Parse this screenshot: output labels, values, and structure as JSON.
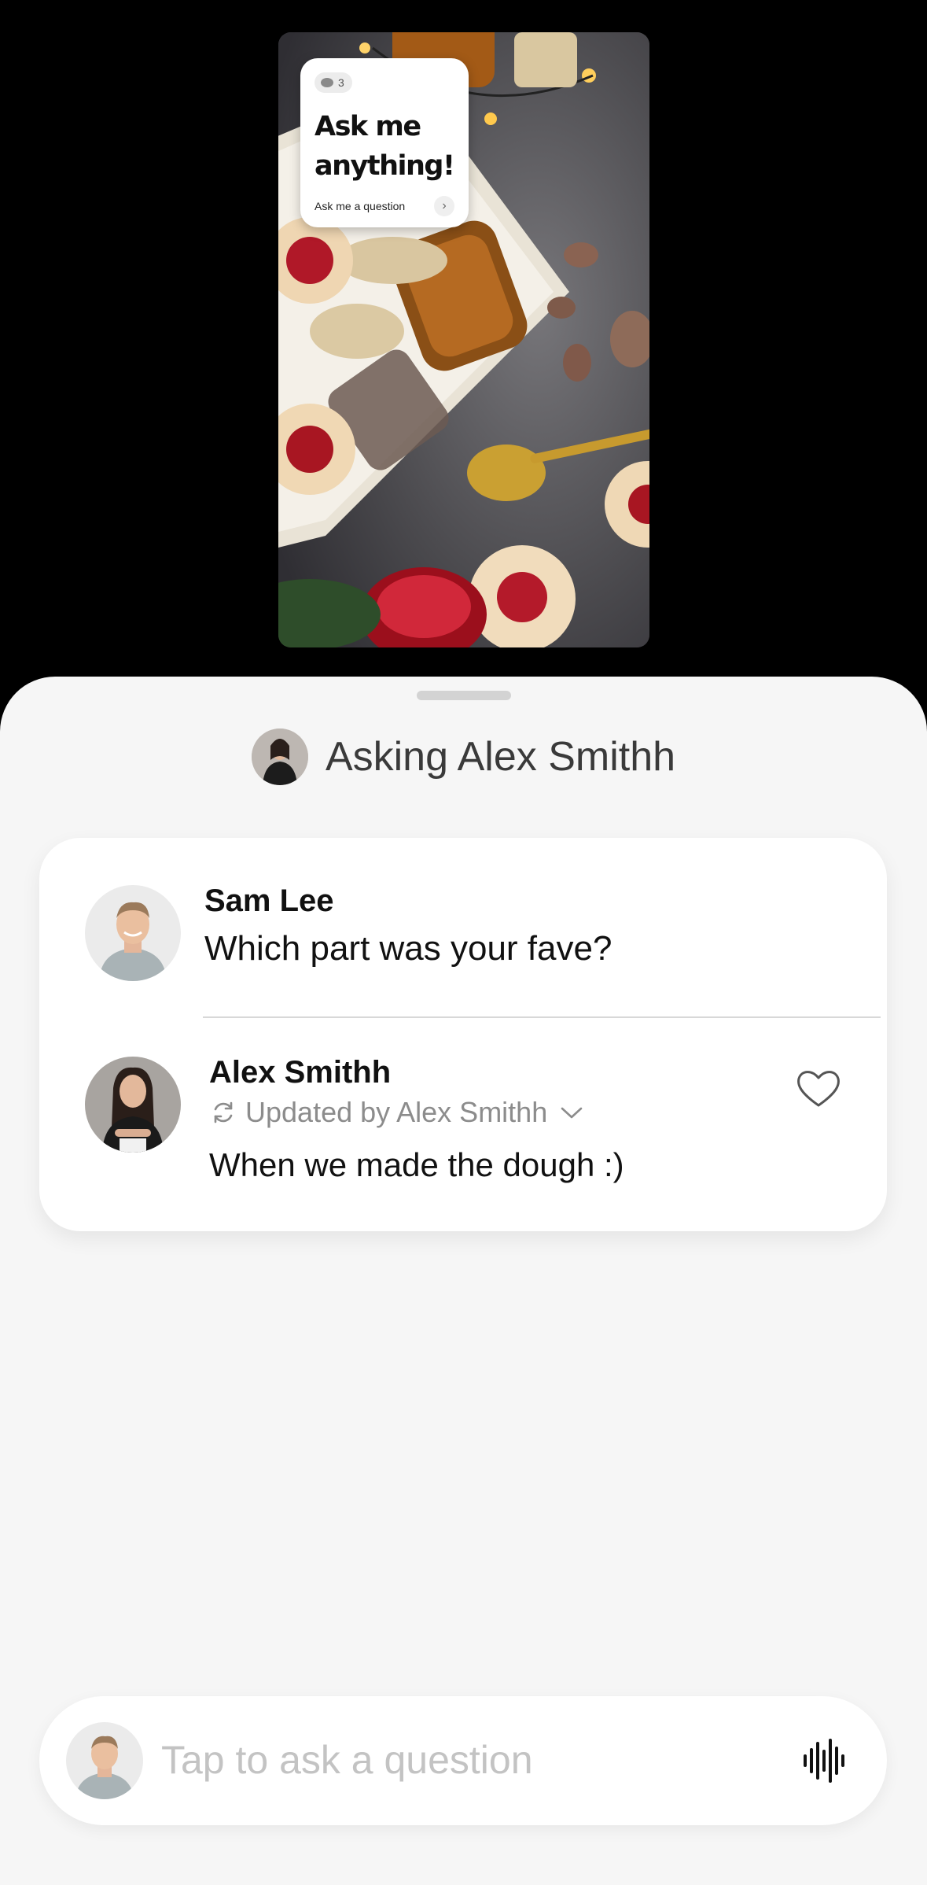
{
  "story": {
    "sticker": {
      "response_count": "3",
      "title": "Ask me anything!",
      "prompt": "Ask me a question"
    }
  },
  "sheet": {
    "title": "Asking Alex Smithh"
  },
  "thread": {
    "question": {
      "author": "Sam Lee",
      "text": "Which part was your fave?"
    },
    "answer": {
      "author": "Alex Smithh",
      "updated_label": "Updated by Alex Smithh",
      "text": "When we made the dough :)"
    }
  },
  "composer": {
    "placeholder": "Tap to ask a question"
  },
  "icons": {
    "sync": "sync-icon",
    "chevron": "chevron-down-icon",
    "heart": "heart-icon",
    "voice": "waveform-icon",
    "arrow": "chevron-right-icon"
  }
}
